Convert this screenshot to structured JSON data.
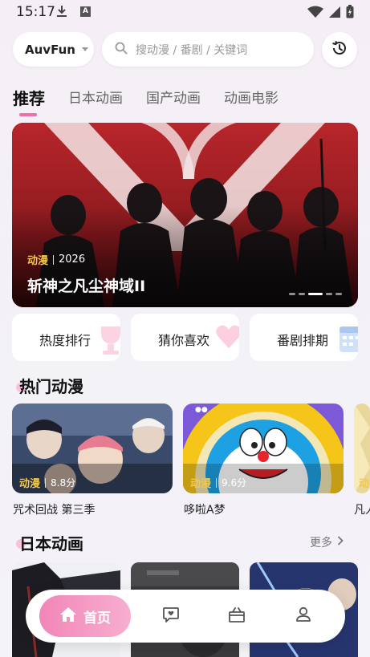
{
  "status_bar": {
    "time": "15:17",
    "a_badge": "A"
  },
  "header": {
    "brand": "AuvFun",
    "search_placeholder": "搜动漫 / 番剧 / 关键词"
  },
  "tabs": [
    {
      "label": "推荐",
      "active": true
    },
    {
      "label": "日本动画",
      "active": false
    },
    {
      "label": "国产动画",
      "active": false
    },
    {
      "label": "动画电影",
      "active": false
    }
  ],
  "banner": {
    "tag": "动漫",
    "year": "2026",
    "title": "斩神之凡尘神域II",
    "dot_count": 5,
    "active_dot": 3
  },
  "quick_links": [
    {
      "label": "热度排行"
    },
    {
      "label": "猜你喜欢"
    },
    {
      "label": "番剧排期"
    }
  ],
  "hot_section": {
    "title": "热门动漫",
    "items": [
      {
        "tag": "动漫",
        "score": "8.8分",
        "title": "咒术回战 第三季"
      },
      {
        "tag": "动漫",
        "score": "9.6分",
        "title": "哆啦A梦"
      },
      {
        "tag": "动",
        "score": "",
        "title": "凡人"
      }
    ]
  },
  "japan_section": {
    "title": "日本动画",
    "more": "更多"
  },
  "bottom_nav": {
    "home_label": "首页"
  },
  "colors": {
    "accent_pink": "#f06fa8",
    "gold_tag": "#f4c84a"
  }
}
